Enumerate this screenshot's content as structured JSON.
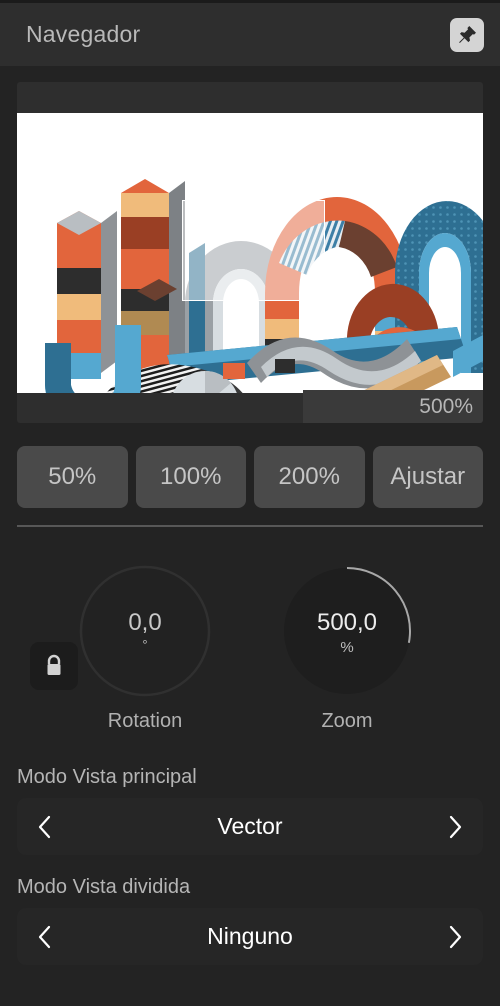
{
  "header": {
    "title": "Navegador",
    "pin_icon": "pin-icon"
  },
  "preview": {
    "zoom_readout": "500%",
    "viewport_rect_label": "viewport-rectangle"
  },
  "presets": [
    {
      "label": "50%"
    },
    {
      "label": "100%"
    },
    {
      "label": "200%"
    },
    {
      "label": "Ajustar"
    }
  ],
  "controls": {
    "lock_icon": "lock-closed-icon",
    "rotation": {
      "value": "0,0",
      "unit": "°",
      "caption": "Rotation",
      "arc_percent": 0
    },
    "zoom": {
      "value": "500,0",
      "unit": "%",
      "caption": "Zoom",
      "arc_percent": 28
    }
  },
  "view_modes": {
    "primary": {
      "label": "Modo Vista principal",
      "value": "Vector",
      "prev_icon": "chevron-left-icon",
      "next_icon": "chevron-right-icon"
    },
    "split": {
      "label": "Modo Vista dividida",
      "value": "Ninguno",
      "prev_icon": "chevron-left-icon",
      "next_icon": "chevron-right-icon"
    }
  },
  "colors": {
    "panel_bg": "#232323",
    "header_bg": "#2e2e2e",
    "button_bg": "#4a4a4a",
    "stepper_bg": "#262626",
    "text_primary": "#ffffff",
    "text_muted": "#b5b5b5",
    "divider": "#575757",
    "pin_bg": "#d4d4d4"
  }
}
